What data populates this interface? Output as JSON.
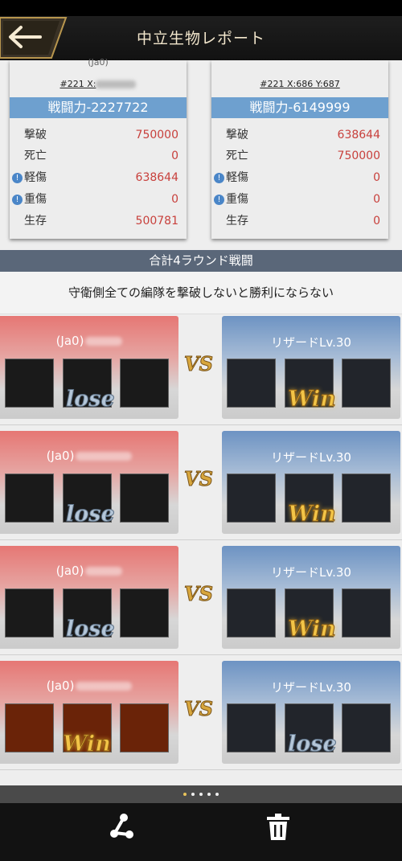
{
  "header": {
    "title": "中立生物レポート",
    "back_icon": "arrow-left-icon"
  },
  "attacker_panel": {
    "top_text": "(Ja0)",
    "coord_label": "#221  X:",
    "power_label": "戦闘力-2227722",
    "stats": [
      {
        "label": "撃破",
        "value": "750000",
        "info": false
      },
      {
        "label": "死亡",
        "value": "0",
        "info": false
      },
      {
        "label": "軽傷",
        "value": "638644",
        "info": true
      },
      {
        "label": "重傷",
        "value": "0",
        "info": true
      },
      {
        "label": "生存",
        "value": "500781",
        "info": false
      }
    ]
  },
  "defender_panel": {
    "coord_label": "#221  X:686  Y:687",
    "power_label": "戦闘力-6149999",
    "stats": [
      {
        "label": "撃破",
        "value": "638644",
        "info": false
      },
      {
        "label": "死亡",
        "value": "750000",
        "info": false
      },
      {
        "label": "軽傷",
        "value": "0",
        "info": true
      },
      {
        "label": "重傷",
        "value": "0",
        "info": true
      },
      {
        "label": "生存",
        "value": "0",
        "info": false
      }
    ]
  },
  "rounds_header": "合計4ラウンド戦闘",
  "rule_text": "守衛側全ての編隊を撃破しないと勝利にならない",
  "vs_label": "VS",
  "result_labels": {
    "lose": "lose",
    "win": "Win"
  },
  "battles": [
    {
      "left_name": "(Ja0)",
      "right_name": "リザードLv.30",
      "left_result": "lose",
      "right_result": "Win"
    },
    {
      "left_name": "(Ja0)",
      "right_name": "リザードLv.30",
      "left_result": "lose",
      "right_result": "Win"
    },
    {
      "left_name": "(Ja0)",
      "right_name": "リザードLv.30",
      "left_result": "lose",
      "right_result": "Win"
    },
    {
      "left_name": "(Ja0)",
      "right_name": "リザードLv.30",
      "left_result": "Win",
      "right_result": "lose"
    }
  ],
  "pagination": {
    "count": 5,
    "active": 0
  },
  "footer": {
    "share_icon": "share-icon",
    "delete_icon": "trash-icon"
  },
  "colors": {
    "value_red": "#c8403c",
    "power_blue": "#6ea0cf",
    "win_gold": "#f2c447",
    "lose_blue": "#b4c6d8"
  }
}
